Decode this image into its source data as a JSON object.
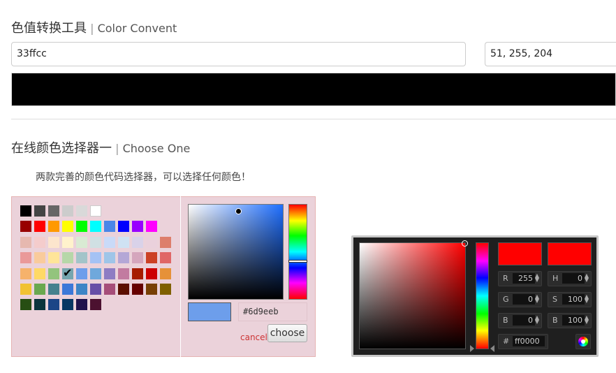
{
  "section1": {
    "title_cn": "色值转换工具",
    "title_sep": " | ",
    "title_en": "Color Convent"
  },
  "converter": {
    "hex_value": "33ffcc",
    "rgb_value": "51, 255, 204",
    "preview_color": "#000000"
  },
  "section2": {
    "title_cn": "在线颜色选择器一",
    "title_sep": " | ",
    "title_en": "Choose One",
    "description": "两款完善的颜色代码选择器，可以选择任何颜色！"
  },
  "picker1": {
    "selected_swatch": "#76a5af",
    "palette_rows": [
      [
        "#000000",
        "#444444",
        "#666666",
        "#cccccc",
        "#d9d9d9",
        "#ffffff"
      ],
      [
        "#980000",
        "#ff0000",
        "#ff9900",
        "#ffff00",
        "#00ff00",
        "#00ffff",
        "#4a86e8",
        "#0000ff",
        "#9900ff",
        "#ff00ff"
      ],
      [
        "#e6b8af",
        "#f4cccc",
        "#fce5cd",
        "#fff2cc",
        "#d9ead3",
        "#d0e0e3",
        "#c9daf8",
        "#cfe2f3",
        "#d9d2e9",
        "#ead1dc",
        "#dd7e6b"
      ],
      [
        "#ea9999",
        "#f9cb9c",
        "#ffe599",
        "#b6d7a8",
        "#a2c4c9",
        "#a4c2f4",
        "#9fc5e8",
        "#b4a7d6",
        "#d5a6bd",
        "#cc4125",
        "#e06666"
      ],
      [
        "#f6b26b",
        "#ffd966",
        "#93c47d",
        "#76a5af",
        "#6d9eeb",
        "#6fa8dc",
        "#8e7cc3",
        "#c27ba0",
        "#a61c00",
        "#cc0000",
        "#e69138"
      ],
      [
        "#f1c232",
        "#6aa84f",
        "#45818e",
        "#3c78d8",
        "#3d85c6",
        "#674ea7",
        "#a64d79",
        "#5b0f00",
        "#660000",
        "#783f04",
        "#7f6000"
      ],
      [
        "#274e13",
        "#0c343d",
        "#1c4587",
        "#073763",
        "#20124d",
        "#4c1130"
      ]
    ],
    "sv_hue_color": "#1f6fff",
    "preview_color": "#6d9eeb",
    "hex_value": "#6d9eeb",
    "cancel_label": "cancel",
    "choose_label": "choose"
  },
  "picker2": {
    "new_color": "#ff0000",
    "current_color": "#ff0000",
    "fields": [
      {
        "label": "R",
        "value": "255"
      },
      {
        "label": "H",
        "value": "0"
      },
      {
        "label": "G",
        "value": "0"
      },
      {
        "label": "S",
        "value": "100"
      },
      {
        "label": "B",
        "value": "0"
      },
      {
        "label": "B",
        "value": "100"
      }
    ],
    "hex_label": "#",
    "hex_value": "ff0000"
  }
}
